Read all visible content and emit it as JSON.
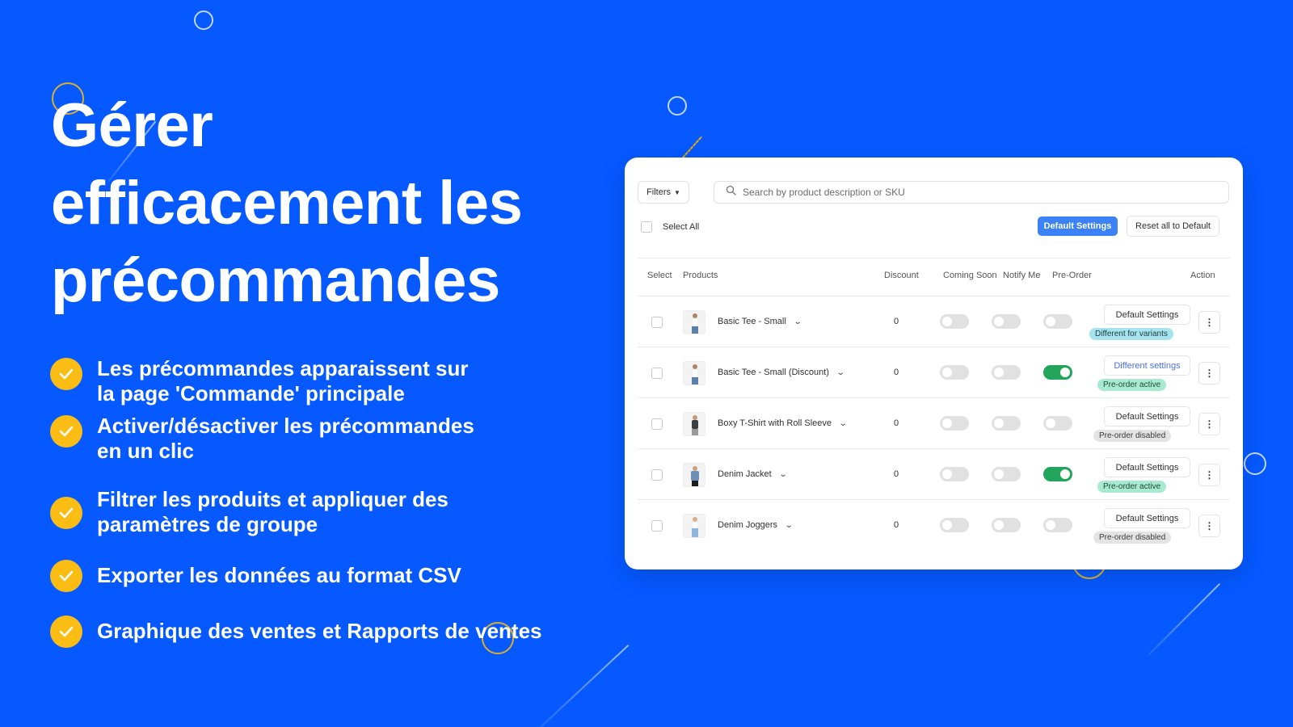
{
  "headline": {
    "lines": [
      "Gérer",
      "efficacement les",
      "précommandes"
    ]
  },
  "features": [
    {
      "lines": [
        "Les précommandes apparaissent sur",
        "la page 'Commande' principale"
      ]
    },
    {
      "lines": [
        "Activer/désactiver les précommandes",
        "en un clic"
      ]
    },
    {
      "lines": [
        "Filtrer les produits et appliquer des",
        "paramètres de groupe"
      ]
    },
    {
      "lines": [
        "Exporter les données au format CSV"
      ]
    },
    {
      "lines": [
        "Graphique des ventes et Rapports de ventes"
      ]
    }
  ],
  "colors": {
    "background": "#0559ff",
    "check": "#fbbd14",
    "primary_button": "#3b82f6",
    "toggle_on": "#22a55b",
    "toggle_off": "#e1e1e1"
  },
  "app": {
    "filters_label": "Filters",
    "search_placeholder": "Search by product description or SKU",
    "select_all_label": "Select All",
    "default_settings_label": "Default Settings",
    "reset_label": "Reset all to Default",
    "columns": {
      "select": "Select",
      "products": "Products",
      "discount": "Discount",
      "coming_soon": "Coming Soon",
      "notify_me": "Notify Me",
      "pre_order": "Pre-Order",
      "action": "Action"
    },
    "rows": [
      {
        "product": "Basic Tee - Small",
        "discount": "0",
        "coming_soon": false,
        "notify_me": false,
        "pre_order": false,
        "setting": "Default Settings",
        "setting_type": "default",
        "badge": "Different for variants",
        "badge_type": "variants",
        "thumb": "white-tee"
      },
      {
        "product": "Basic Tee - Small (Discount)",
        "discount": "0",
        "coming_soon": false,
        "notify_me": false,
        "pre_order": true,
        "setting": "Different settings",
        "setting_type": "diff",
        "badge": "Pre-order active",
        "badge_type": "active",
        "thumb": "white-tee"
      },
      {
        "product": "Boxy T-Shirt with Roll Sleeve",
        "discount": "0",
        "coming_soon": false,
        "notify_me": false,
        "pre_order": false,
        "setting": "Default Settings",
        "setting_type": "default",
        "badge": "Pre-order disabled",
        "badge_type": "disabled",
        "thumb": "dark-tee"
      },
      {
        "product": "Denim Jacket",
        "discount": "0",
        "coming_soon": false,
        "notify_me": false,
        "pre_order": true,
        "setting": "Default Settings",
        "setting_type": "default",
        "badge": "Pre-order active",
        "badge_type": "active",
        "thumb": "denim-jacket"
      },
      {
        "product": "Denim Joggers",
        "discount": "0",
        "coming_soon": false,
        "notify_me": false,
        "pre_order": false,
        "setting": "Default Settings",
        "setting_type": "default",
        "badge": "Pre-order disabled",
        "badge_type": "disabled",
        "thumb": "joggers"
      }
    ]
  }
}
